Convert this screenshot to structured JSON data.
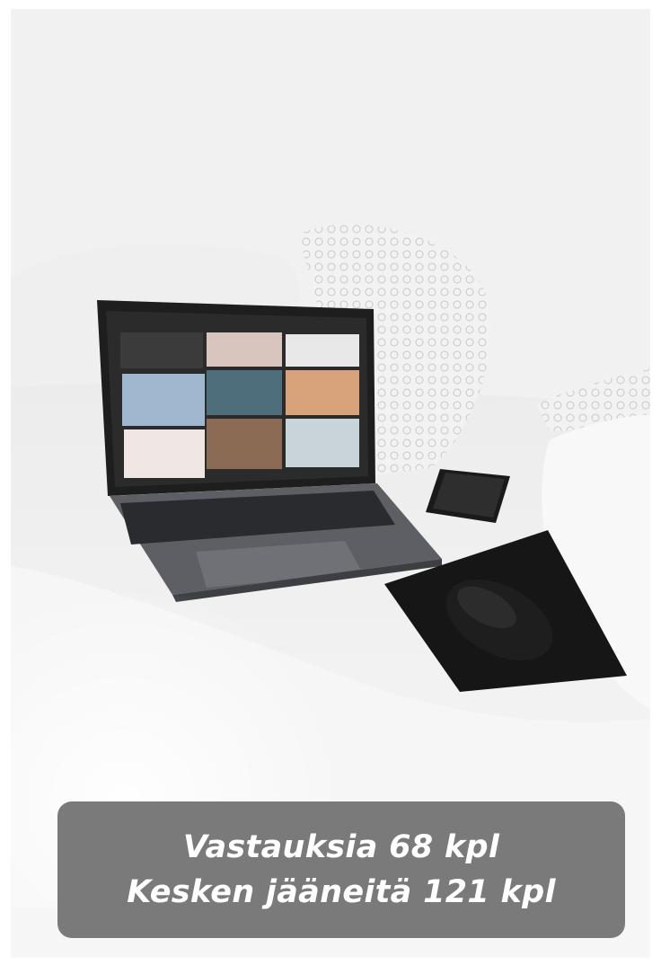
{
  "photo": {
    "subject": "laptop on bed with phone, mouse and mouse pad",
    "icons": [
      "laptop-icon",
      "phone-icon",
      "mouse-icon"
    ]
  },
  "caption": {
    "line1": "Vastauksia 68 kpl",
    "line2": "Kesken jääneitä 121 kpl"
  },
  "colors": {
    "caption_bg": "#707070",
    "caption_text": "#ffffff"
  }
}
